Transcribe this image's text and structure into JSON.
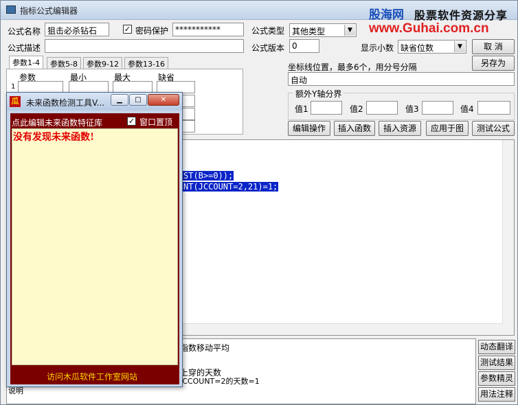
{
  "window": {
    "title": "指标公式编辑器",
    "brand_top": "股海网",
    "brand_top_suffix": "股票软件资源分享",
    "brand_url": "www.Guhai.com.cn"
  },
  "form": {
    "name_label": "公式名称",
    "name_value": "狙击必杀钻石",
    "password_label": "密码保护",
    "password_checked": true,
    "password_value": "***********",
    "type_label": "公式类型",
    "type_value": "其他类型",
    "desc_label": "公式描述",
    "desc_value": "",
    "version_label": "公式版本",
    "version_value": "0",
    "decimal_label": "显示小数",
    "decimal_value": "缺省位数",
    "cancel_label": "取  消",
    "save_as_label": "另存为",
    "coord_label": "坐标线位置，最多6个，用分号分隔",
    "coord_value": "自动",
    "yaxis_group_title": "额外Y轴分界",
    "val1": "值1",
    "val2": "值2",
    "val3": "值3",
    "val4": "值4"
  },
  "param_tabs": [
    "参数1-4",
    "参数5-8",
    "参数9-12",
    "参数13-16"
  ],
  "param_headers": {
    "param": "参数",
    "min": "最小",
    "max": "最大",
    "default": "缺省"
  },
  "param_row_number": "1",
  "action_buttons": [
    "编辑操作",
    "插入函数",
    "插入资源",
    "应用于图",
    "测试公式"
  ],
  "editor": {
    "line1": "ST(B>=0));",
    "line2": "NT(JCCOUNT=2,21)=1;"
  },
  "notes": {
    "line1": "指数移动平均",
    "line2": "上穿的天数",
    "line3": "JCCOUNT=2的天数=1",
    "line4": "说明"
  },
  "side_buttons": [
    "动态翻译",
    "测试结果",
    "参数精灵",
    "用法注释"
  ],
  "tool_window": {
    "title": "未来函数检测工具V...",
    "edit_link": "点此编辑未来函数特征库",
    "topmost_label": "窗口置顶",
    "topmost_checked": true,
    "result": "没有发现未来函数!",
    "footer": "访问木瓜软件工作室网站"
  }
}
